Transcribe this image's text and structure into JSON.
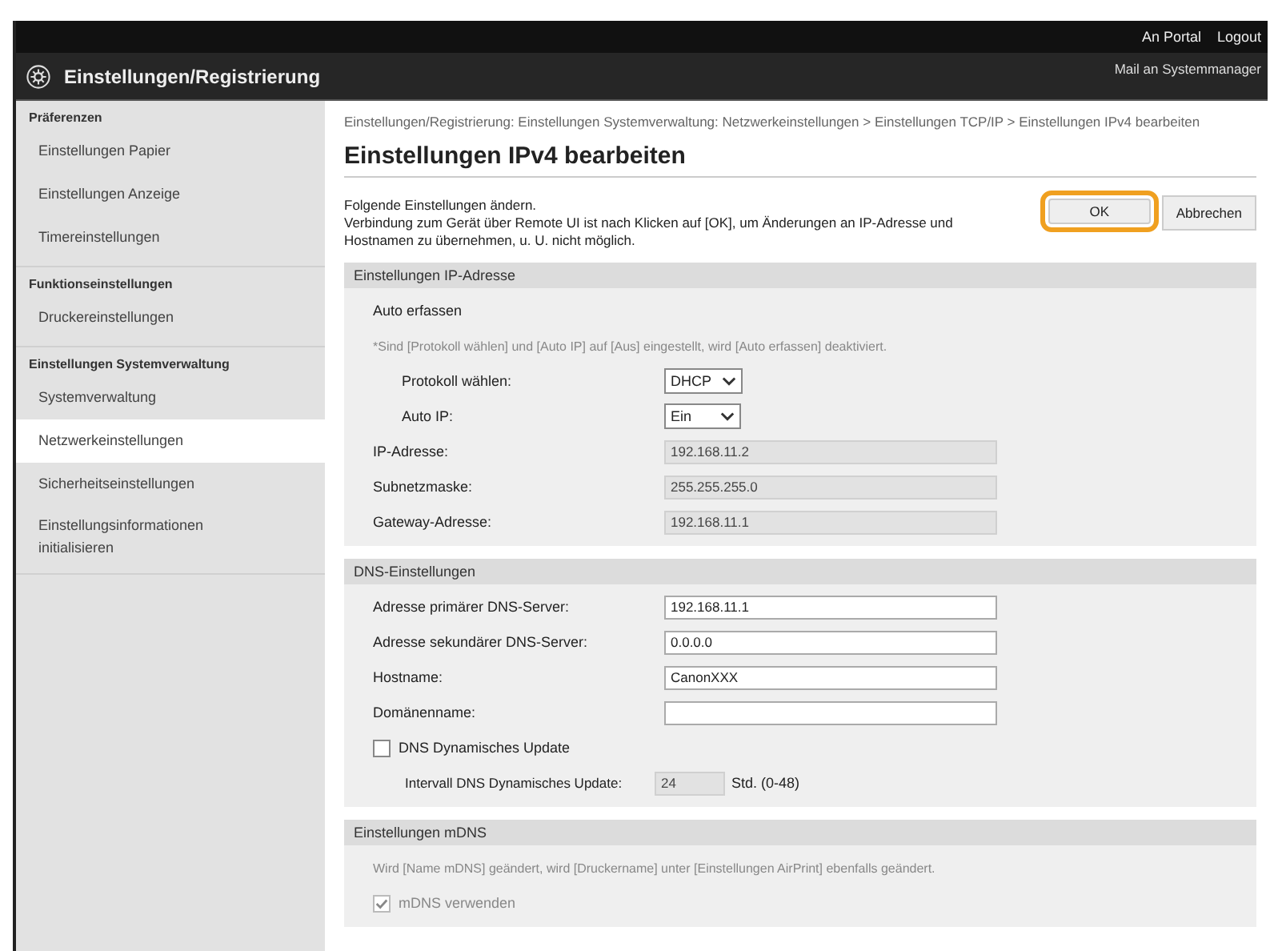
{
  "top_bar": {
    "links": [
      "An Portal",
      "Logout"
    ]
  },
  "header": {
    "title": "Einstellungen/Registrierung",
    "mail_link": "Mail an Systemmanager"
  },
  "sidebar": {
    "groups": [
      {
        "heading": "Präferenzen",
        "items": [
          {
            "label": "Einstellungen Papier",
            "selected": false
          },
          {
            "label": "Einstellungen Anzeige",
            "selected": false
          },
          {
            "label": "Timereinstellungen",
            "selected": false
          }
        ]
      },
      {
        "heading": "Funktionseinstellungen",
        "items": [
          {
            "label": "Druckereinstellungen",
            "selected": false
          }
        ]
      },
      {
        "heading": "Einstellungen Systemverwaltung",
        "items": [
          {
            "label": "Systemverwaltung",
            "selected": false
          },
          {
            "label": "Netzwerkeinstellungen",
            "selected": true
          },
          {
            "label": "Sicherheitseinstellungen",
            "selected": false
          },
          {
            "label": "Einstellungsinformationen initialisieren",
            "selected": false
          }
        ]
      }
    ]
  },
  "breadcrumb": "Einstellungen/Registrierung: Einstellungen Systemverwaltung: Netzwerkeinstellungen > Einstellungen TCP/IP > Einstellungen IPv4 bearbeiten",
  "page_title": "Einstellungen IPv4 bearbeiten",
  "description": [
    "Folgende Einstellungen ändern.",
    "Verbindung zum Gerät über Remote UI ist nach Klicken auf [OK], um Änderungen an IP-Adresse und Hostnamen zu übernehmen, u. U. nicht möglich."
  ],
  "buttons": [
    {
      "label": "OK",
      "highlighted": true
    },
    {
      "label": "Abbrechen",
      "highlighted": false
    }
  ],
  "sections": [
    {
      "title": "Einstellungen IP-Adresse",
      "rows": [
        {
          "kind": "label",
          "label": "Auto erfassen"
        },
        {
          "kind": "note",
          "label": "*Sind [Protokoll wählen] und [Auto IP] auf [Aus] eingestellt, wird [Auto erfassen] deaktiviert."
        },
        {
          "kind": "select",
          "label": "Protokoll wählen:",
          "value": "DHCP",
          "indent": true
        },
        {
          "kind": "select",
          "label": "Auto IP:",
          "value": "Ein",
          "indent": true
        },
        {
          "kind": "input",
          "label": "IP-Adresse:",
          "value": "192.168.11.2",
          "disabled": true
        },
        {
          "kind": "input",
          "label": "Subnetzmaske:",
          "value": "255.255.255.0",
          "disabled": true
        },
        {
          "kind": "input",
          "label": "Gateway-Adresse:",
          "value": "192.168.11.1",
          "disabled": true
        }
      ]
    },
    {
      "title": "DNS-Einstellungen",
      "rows": [
        {
          "kind": "input",
          "label": "Adresse primärer DNS-Server:",
          "value": "192.168.11.1",
          "disabled": false
        },
        {
          "kind": "input",
          "label": "Adresse sekundärer DNS-Server:",
          "value": "0.0.0.0",
          "disabled": false
        },
        {
          "kind": "input",
          "label": "Hostname:",
          "value": "CanonXXX",
          "disabled": false
        },
        {
          "kind": "input",
          "label": "Domänenname:",
          "value": "",
          "disabled": false
        },
        {
          "kind": "checkbox",
          "label": "DNS Dynamisches Update",
          "checked": false,
          "disabled": false
        },
        {
          "kind": "interval",
          "label": "Intervall DNS Dynamisches Update:",
          "value": "24",
          "unit": "Std. (0-48)"
        }
      ]
    },
    {
      "title": "Einstellungen mDNS",
      "rows": [
        {
          "kind": "note",
          "label": "Wird [Name mDNS] geändert, wird [Druckername] unter [Einstellungen AirPrint] ebenfalls geändert."
        },
        {
          "kind": "checkbox",
          "label": "mDNS verwenden",
          "checked": true,
          "disabled": true
        }
      ]
    }
  ]
}
